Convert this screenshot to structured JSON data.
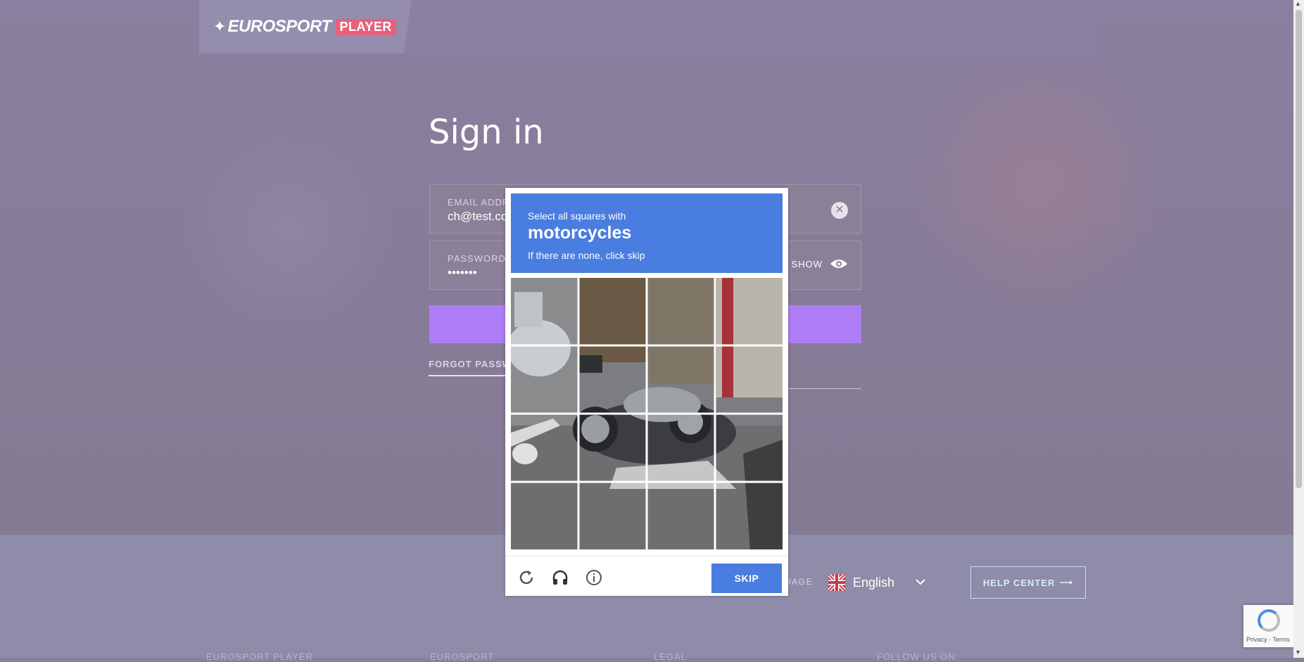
{
  "header": {
    "logo_text": "EUROSPORT",
    "logo_badge": "PLAYER"
  },
  "signin": {
    "title": "Sign in",
    "email_label": "EMAIL ADDR",
    "email_value": "ch@test.co",
    "password_label": "PASSWORD",
    "password_value": "•••••••",
    "show_label": "SHOW",
    "forgot_label": "FORGOT PASSW"
  },
  "footer": {
    "language_label": "UAGE",
    "language_value": "English",
    "help_label": "HELP CENTER",
    "columns": [
      "EUROSPORT PLAYER",
      "EUROSPORT",
      "LEGAL",
      "FOLLOW US ON:"
    ]
  },
  "captcha": {
    "line1": "Select all squares with",
    "line2": "motorcycles",
    "line3": "If there are none, click skip",
    "skip_label": "SKIP",
    "tiles": 16
  },
  "recaptcha_badge": {
    "terms": "Privacy - Terms"
  },
  "colors": {
    "accent": "#ae7df5",
    "captcha_blue": "#4a7de0",
    "logo_badge": "#e8607b"
  }
}
